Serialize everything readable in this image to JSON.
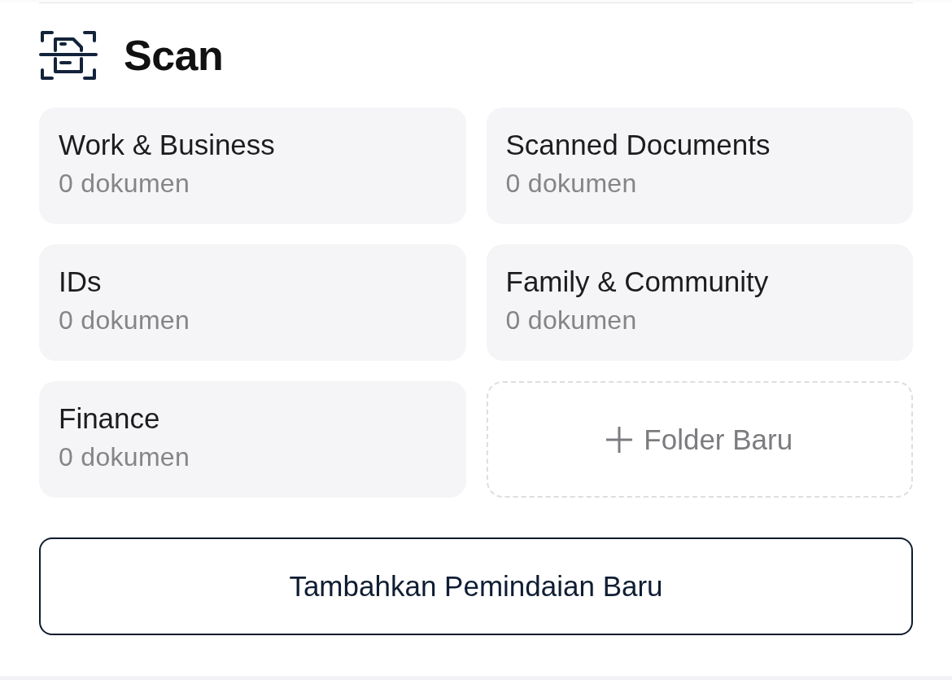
{
  "header": {
    "title": "Scan"
  },
  "folders": [
    {
      "kind": "folder",
      "name": "Work & Business",
      "count": "0 dokumen"
    },
    {
      "kind": "folder",
      "name": "Scanned Documents",
      "count": "0 dokumen"
    },
    {
      "kind": "folder",
      "name": "IDs",
      "count": "0 dokumen"
    },
    {
      "kind": "folder",
      "name": "Family & Community",
      "count": "0 dokumen"
    },
    {
      "kind": "folder",
      "name": "Finance",
      "count": "0 dokumen"
    },
    {
      "kind": "new",
      "label": "Folder Baru"
    }
  ],
  "primary_button": {
    "label": "Tambahkan Pemindaian Baru"
  }
}
